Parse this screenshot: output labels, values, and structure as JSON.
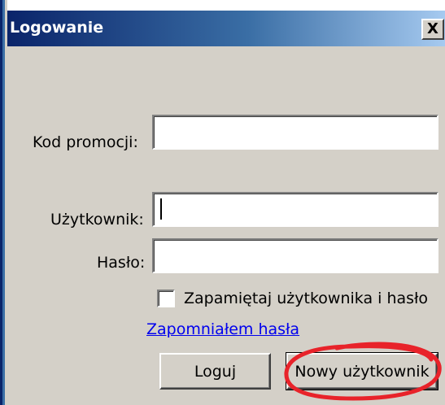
{
  "window": {
    "title": "Logowanie",
    "close_label": "X"
  },
  "form": {
    "promo_label": "Kod promocji:",
    "promo_value": "",
    "user_label": "Użytkownik:",
    "user_value": "",
    "password_label": "Hasło:",
    "password_value": "",
    "remember_label": "Zapamiętaj użytkownika i hasło",
    "remember_checked": false,
    "forgot_link": "Zapomniałem hasła"
  },
  "buttons": {
    "login_label": "Loguj",
    "new_user_label": "Nowy użytkownik"
  },
  "annotation": {
    "color": "#e8232a"
  }
}
